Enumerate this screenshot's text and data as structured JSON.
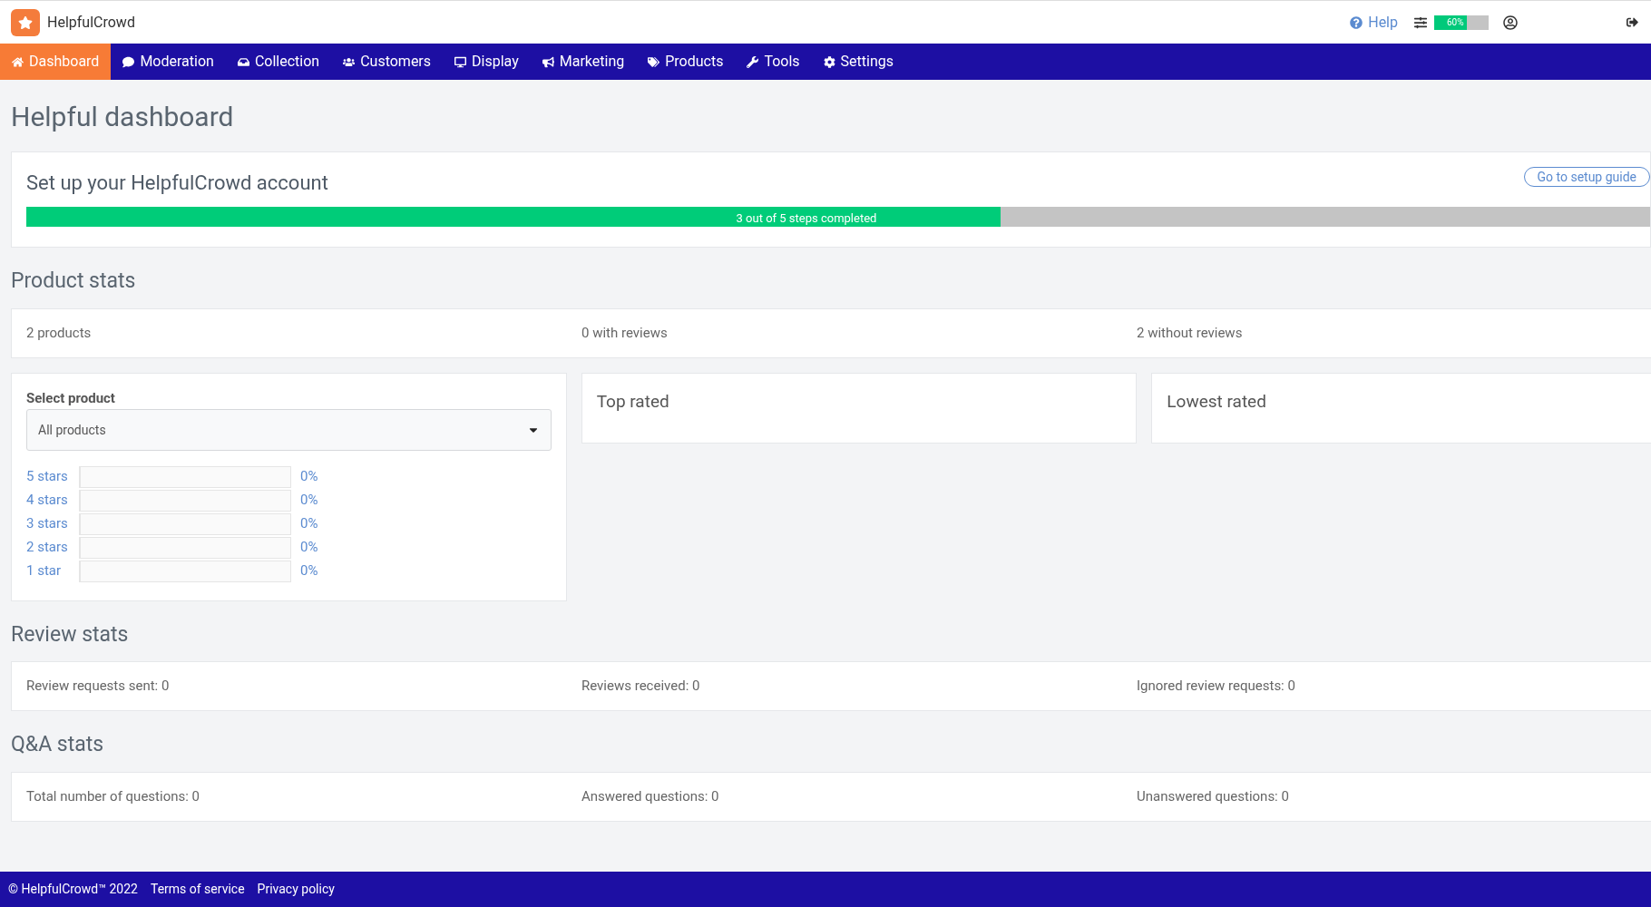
{
  "header": {
    "brand": "HelpfulCrowd",
    "help": "Help",
    "usage": {
      "level": 0.6,
      "reading": "60%"
    }
  },
  "nav": [
    {
      "label": "Dashboard",
      "selected": true
    },
    {
      "label": "Moderation",
      "selected": false
    },
    {
      "label": "Collection",
      "selected": false
    },
    {
      "label": "Customers",
      "selected": false
    },
    {
      "label": "Display",
      "selected": false
    },
    {
      "label": "Marketing",
      "selected": false
    },
    {
      "label": "Products",
      "selected": false
    },
    {
      "label": "Tools",
      "selected": false
    },
    {
      "label": "Settings",
      "selected": false
    }
  ],
  "page_title": "Helpful dashboard",
  "setup": {
    "title": "Set up your HelpfulCrowd account",
    "button": "Go to setup guide",
    "level": 0.6,
    "reading": "3 out of 5 steps completed"
  },
  "product_stats": {
    "title": "Product stats",
    "items": [
      "2 products",
      "0 with reviews",
      "2 without reviews"
    ]
  },
  "rating": {
    "label": "Select product",
    "value": "All products",
    "rows": [
      {
        "label": "5 stars",
        "level": 0,
        "reading": "0%"
      },
      {
        "label": "4 stars",
        "level": 0,
        "reading": "0%"
      },
      {
        "label": "3 stars",
        "level": 0,
        "reading": "0%"
      },
      {
        "label": "2 stars",
        "level": 0,
        "reading": "0%"
      },
      {
        "label": "1 star",
        "level": 0,
        "reading": "0%"
      }
    ]
  },
  "top_rated": "Top rated",
  "lowest_rated": "Lowest rated",
  "review_stats": {
    "title": "Review stats",
    "items": [
      "Review requests sent: 0",
      "Reviews received: 0",
      "Ignored review requests: 0"
    ]
  },
  "qa_stats": {
    "title": "Q&A stats",
    "items": [
      "Total number of questions: 0",
      "Answered questions: 0",
      "Unanswered questions: 0"
    ]
  },
  "footer": [
    "© HelpfulCrowd™ 2022",
    "Terms of service",
    "Privacy policy"
  ]
}
